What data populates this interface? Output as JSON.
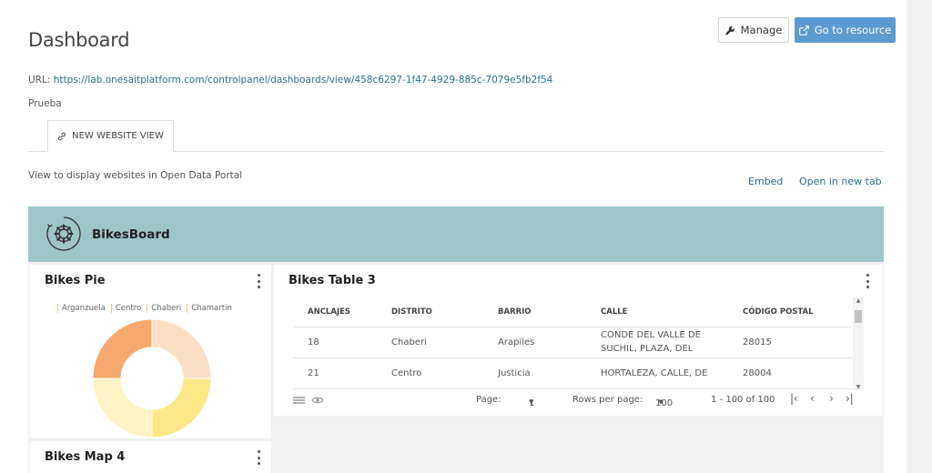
{
  "header": {
    "title": "Dashboard",
    "manage_label": "Manage",
    "go_label": "Go to resource"
  },
  "info": {
    "url_label": "URL:",
    "url_value": "https://lab.onesaitplatform.com/controlpanel/dashboards/view/458c6297-1f47-4929-885c-7079e5fb2f54",
    "description": "Prueba"
  },
  "tabs": [
    {
      "label": "NEW WEBSITE VIEW",
      "icon": "link-icon"
    }
  ],
  "view": {
    "description": "View to display websites in Open Data Portal",
    "embed_label": "Embed",
    "open_label": "Open in new tab"
  },
  "dashboard": {
    "title": "BikesBoard",
    "icon": "gear-cycle-icon",
    "accent": "#9ec5c8"
  },
  "pie": {
    "title": "Bikes Pie",
    "legend": [
      "Arganzuela",
      "Centro",
      "Chaberi",
      "Chamartin"
    ],
    "chart_data": {
      "type": "pie",
      "categories": [
        "Arganzuela",
        "Centro",
        "Chaberi",
        "Chamartin"
      ],
      "values": [
        25,
        25,
        25,
        25
      ],
      "colors": [
        "#fbe0c6",
        "#fde889",
        "#fef3c4",
        "#f5a96f"
      ]
    }
  },
  "table": {
    "title": "Bikes Table 3",
    "columns": [
      "ANCLAJES",
      "DISTRITO",
      "BARRIO",
      "CALLE",
      "CÓDIGO POSTAL"
    ],
    "rows": [
      [
        "18",
        "Chaberi",
        "Arapiles",
        "CONDE DEL VALLE DE SUCHIL, PLAZA, DEL",
        "28015"
      ],
      [
        "21",
        "Centro",
        "Justicia",
        "HORTALEZA, CALLE, DE",
        "28004"
      ]
    ],
    "pager": {
      "page_label": "Page:",
      "page_value": "1",
      "rows_label": "Rows per page:",
      "rows_value": "100",
      "range": "1 - 100 of 100"
    }
  },
  "map": {
    "title": "Bikes Map 4"
  }
}
